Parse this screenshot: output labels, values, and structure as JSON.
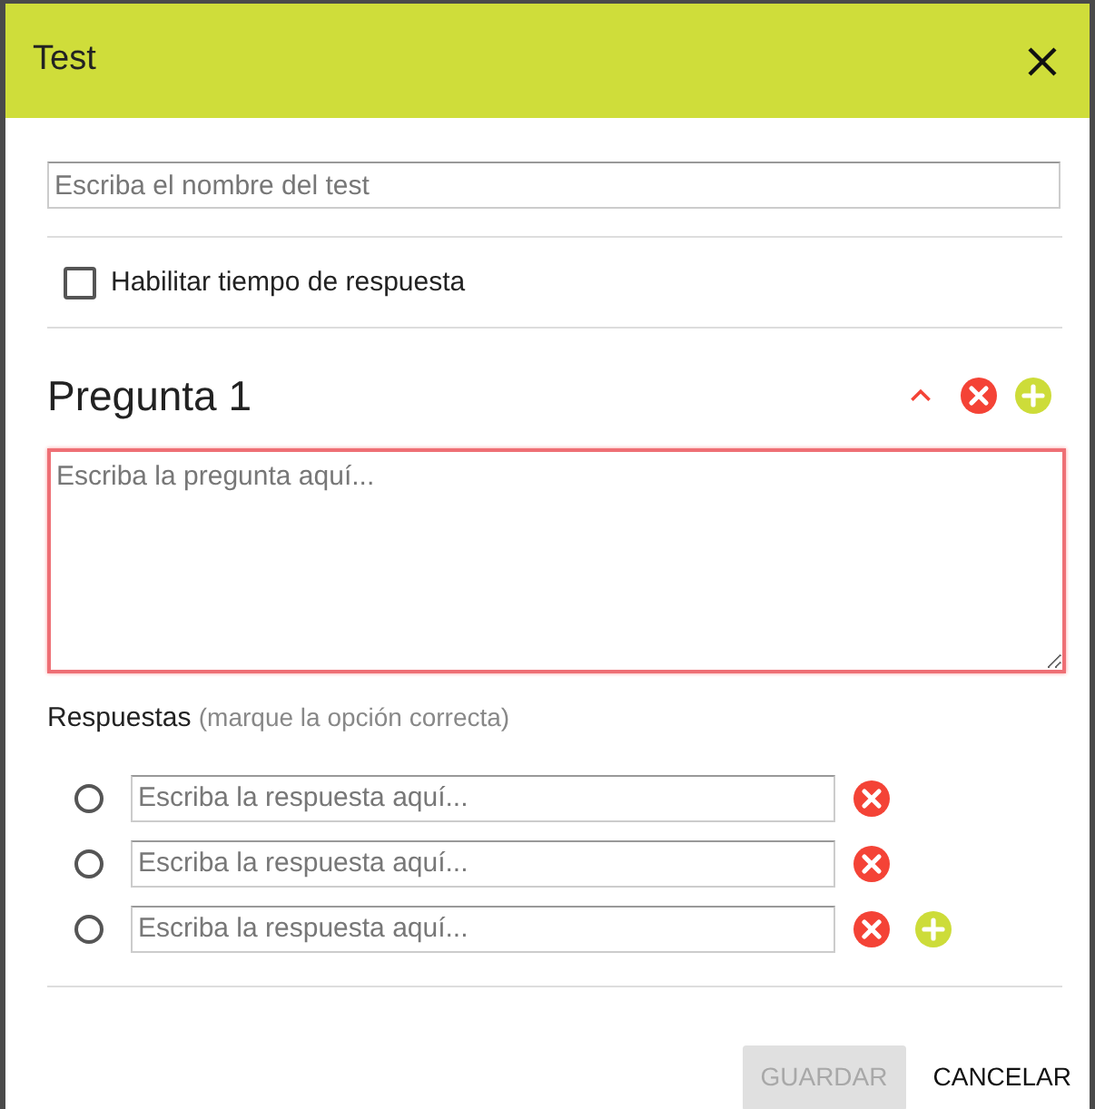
{
  "dialog": {
    "title": "Test"
  },
  "test_name": {
    "placeholder": "Escriba el nombre del test"
  },
  "timer": {
    "label": "Habilitar tiempo de respuesta",
    "checked": false
  },
  "question": {
    "title": "Pregunta 1",
    "expanded": true,
    "invalid": true,
    "placeholder": "Escriba la pregunta aquí..."
  },
  "answers": {
    "label": "Respuestas",
    "hint": "(marque la opción correcta)",
    "items": [
      {
        "placeholder": "Escriba la respuesta aquí...",
        "selected": false,
        "show_add": false
      },
      {
        "placeholder": "Escriba la respuesta aquí...",
        "selected": false,
        "show_add": false
      },
      {
        "placeholder": "Escriba la respuesta aquí...",
        "selected": false,
        "show_add": true
      }
    ]
  },
  "buttons": [
    {
      "label": "GUARDAR",
      "disabled": true
    },
    {
      "label": "CANCELAR",
      "disabled": false
    }
  ]
}
